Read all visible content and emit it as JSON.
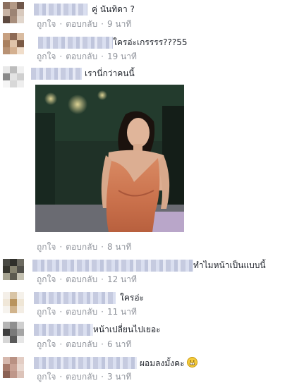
{
  "actions": {
    "like": "ถูกใจ",
    "reply": "ตอบกลับ"
  },
  "comments": [
    {
      "text": "คู่ นันทิดา ?",
      "time": "9 นาที"
    },
    {
      "text": "ใครอ่ะเกรรรร???55",
      "time": "19 นาที"
    },
    {
      "text": "เรานี่กว่าคนนี้",
      "time": "8 นาที"
    },
    {
      "text": "ทำไมหน้าเป็นแบบนี้",
      "time": "12 นาที"
    },
    {
      "text": "ใครอ่ะ",
      "time": "11 นาที"
    },
    {
      "text": "หน้าเปลี่ยนไปเยอะ",
      "time": "6 นาที"
    },
    {
      "text": "ผอมลงมั้งคะ",
      "time": "3 นาที"
    }
  ],
  "icons": {
    "emoji": "grinning-face-emoji",
    "photo": "attached-photo-woman-in-orange-dress"
  },
  "colors": {
    "text": "#1d2129",
    "meta": "#90949c",
    "background": "#ffffff"
  }
}
